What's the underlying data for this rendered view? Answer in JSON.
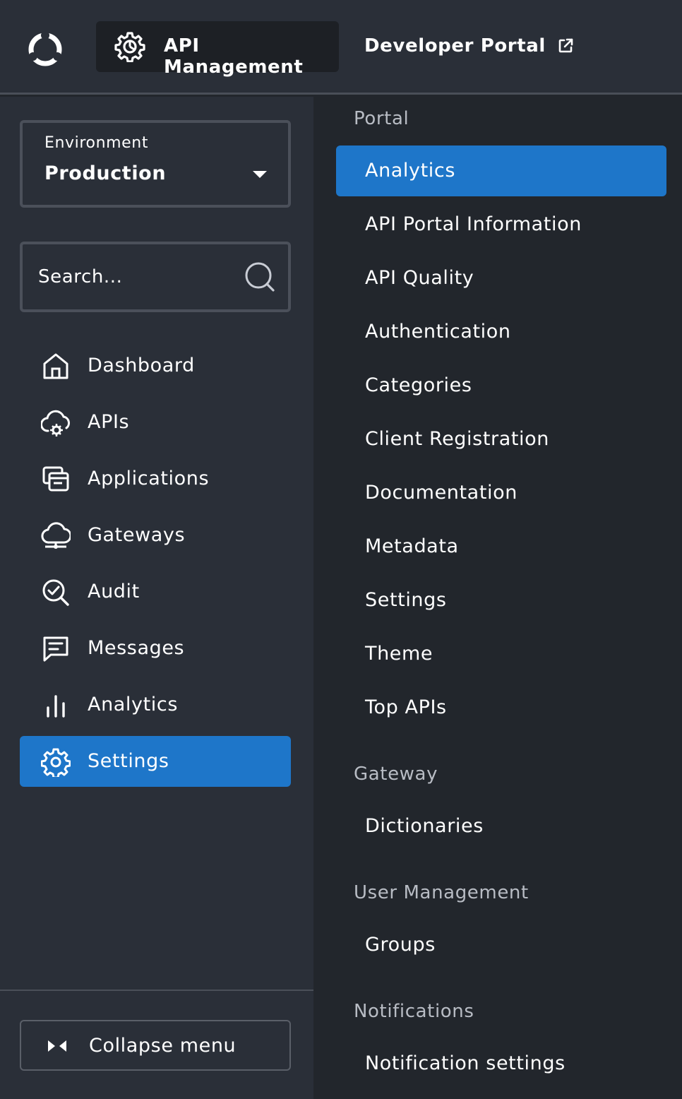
{
  "header": {
    "logo": "logo-icon",
    "app_icon": "gear-icon",
    "app_title": "API Management",
    "developer_portal_label": "Developer Portal",
    "external_icon": "external-link-icon"
  },
  "sidebar": {
    "environment": {
      "caption": "Environment",
      "value": "Production"
    },
    "search": {
      "placeholder": "Search..."
    },
    "items": [
      {
        "label": "Dashboard",
        "icon": "home-icon"
      },
      {
        "label": "APIs",
        "icon": "cloud-gear-icon"
      },
      {
        "label": "Applications",
        "icon": "applications-icon"
      },
      {
        "label": "Gateways",
        "icon": "cloud-gateway-icon"
      },
      {
        "label": "Audit",
        "icon": "audit-icon"
      },
      {
        "label": "Messages",
        "icon": "message-icon"
      },
      {
        "label": "Analytics",
        "icon": "bar-chart-icon"
      },
      {
        "label": "Settings",
        "icon": "settings-icon",
        "active": true
      }
    ],
    "collapse_label": "Collapse menu"
  },
  "submenu": {
    "sections": [
      {
        "title": "Portal",
        "items": [
          {
            "label": "Analytics",
            "active": true
          },
          {
            "label": "API Portal Information"
          },
          {
            "label": "API Quality"
          },
          {
            "label": "Authentication"
          },
          {
            "label": "Categories"
          },
          {
            "label": "Client Registration"
          },
          {
            "label": "Documentation"
          },
          {
            "label": "Metadata"
          },
          {
            "label": "Settings"
          },
          {
            "label": "Theme"
          },
          {
            "label": "Top APIs"
          }
        ]
      },
      {
        "title": "Gateway",
        "items": [
          {
            "label": "Dictionaries"
          }
        ]
      },
      {
        "title": "User Management",
        "items": [
          {
            "label": "Groups"
          }
        ]
      },
      {
        "title": "Notifications",
        "items": [
          {
            "label": "Notification settings"
          }
        ]
      }
    ]
  },
  "colors": {
    "accent": "#1e76c9",
    "sidebar_bg": "#2a2f38",
    "submenu_bg": "#22262c"
  }
}
